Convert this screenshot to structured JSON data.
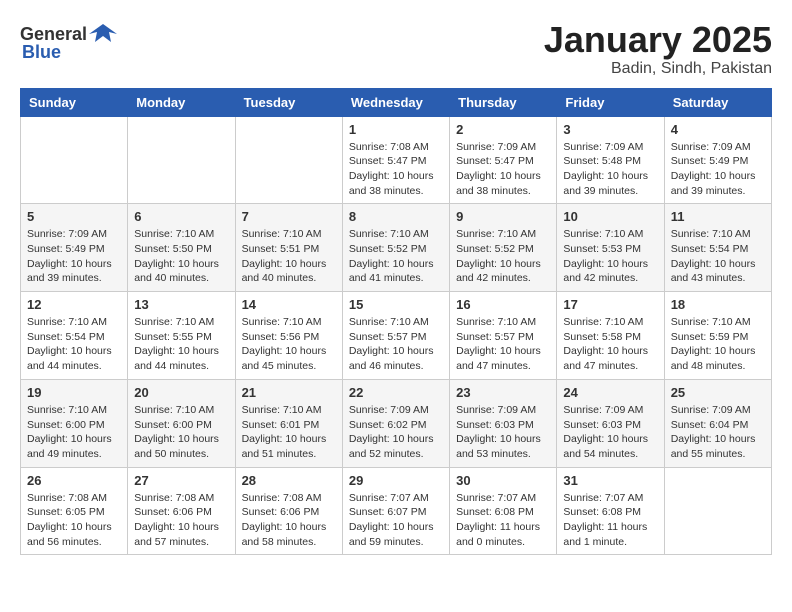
{
  "header": {
    "logo_general": "General",
    "logo_blue": "Blue",
    "month_year": "January 2025",
    "location": "Badin, Sindh, Pakistan"
  },
  "days_of_week": [
    "Sunday",
    "Monday",
    "Tuesday",
    "Wednesday",
    "Thursday",
    "Friday",
    "Saturday"
  ],
  "weeks": [
    [
      {
        "day": "",
        "info": ""
      },
      {
        "day": "",
        "info": ""
      },
      {
        "day": "",
        "info": ""
      },
      {
        "day": "1",
        "info": "Sunrise: 7:08 AM\nSunset: 5:47 PM\nDaylight: 10 hours\nand 38 minutes."
      },
      {
        "day": "2",
        "info": "Sunrise: 7:09 AM\nSunset: 5:47 PM\nDaylight: 10 hours\nand 38 minutes."
      },
      {
        "day": "3",
        "info": "Sunrise: 7:09 AM\nSunset: 5:48 PM\nDaylight: 10 hours\nand 39 minutes."
      },
      {
        "day": "4",
        "info": "Sunrise: 7:09 AM\nSunset: 5:49 PM\nDaylight: 10 hours\nand 39 minutes."
      }
    ],
    [
      {
        "day": "5",
        "info": "Sunrise: 7:09 AM\nSunset: 5:49 PM\nDaylight: 10 hours\nand 39 minutes."
      },
      {
        "day": "6",
        "info": "Sunrise: 7:10 AM\nSunset: 5:50 PM\nDaylight: 10 hours\nand 40 minutes."
      },
      {
        "day": "7",
        "info": "Sunrise: 7:10 AM\nSunset: 5:51 PM\nDaylight: 10 hours\nand 40 minutes."
      },
      {
        "day": "8",
        "info": "Sunrise: 7:10 AM\nSunset: 5:52 PM\nDaylight: 10 hours\nand 41 minutes."
      },
      {
        "day": "9",
        "info": "Sunrise: 7:10 AM\nSunset: 5:52 PM\nDaylight: 10 hours\nand 42 minutes."
      },
      {
        "day": "10",
        "info": "Sunrise: 7:10 AM\nSunset: 5:53 PM\nDaylight: 10 hours\nand 42 minutes."
      },
      {
        "day": "11",
        "info": "Sunrise: 7:10 AM\nSunset: 5:54 PM\nDaylight: 10 hours\nand 43 minutes."
      }
    ],
    [
      {
        "day": "12",
        "info": "Sunrise: 7:10 AM\nSunset: 5:54 PM\nDaylight: 10 hours\nand 44 minutes."
      },
      {
        "day": "13",
        "info": "Sunrise: 7:10 AM\nSunset: 5:55 PM\nDaylight: 10 hours\nand 44 minutes."
      },
      {
        "day": "14",
        "info": "Sunrise: 7:10 AM\nSunset: 5:56 PM\nDaylight: 10 hours\nand 45 minutes."
      },
      {
        "day": "15",
        "info": "Sunrise: 7:10 AM\nSunset: 5:57 PM\nDaylight: 10 hours\nand 46 minutes."
      },
      {
        "day": "16",
        "info": "Sunrise: 7:10 AM\nSunset: 5:57 PM\nDaylight: 10 hours\nand 47 minutes."
      },
      {
        "day": "17",
        "info": "Sunrise: 7:10 AM\nSunset: 5:58 PM\nDaylight: 10 hours\nand 47 minutes."
      },
      {
        "day": "18",
        "info": "Sunrise: 7:10 AM\nSunset: 5:59 PM\nDaylight: 10 hours\nand 48 minutes."
      }
    ],
    [
      {
        "day": "19",
        "info": "Sunrise: 7:10 AM\nSunset: 6:00 PM\nDaylight: 10 hours\nand 49 minutes."
      },
      {
        "day": "20",
        "info": "Sunrise: 7:10 AM\nSunset: 6:00 PM\nDaylight: 10 hours\nand 50 minutes."
      },
      {
        "day": "21",
        "info": "Sunrise: 7:10 AM\nSunset: 6:01 PM\nDaylight: 10 hours\nand 51 minutes."
      },
      {
        "day": "22",
        "info": "Sunrise: 7:09 AM\nSunset: 6:02 PM\nDaylight: 10 hours\nand 52 minutes."
      },
      {
        "day": "23",
        "info": "Sunrise: 7:09 AM\nSunset: 6:03 PM\nDaylight: 10 hours\nand 53 minutes."
      },
      {
        "day": "24",
        "info": "Sunrise: 7:09 AM\nSunset: 6:03 PM\nDaylight: 10 hours\nand 54 minutes."
      },
      {
        "day": "25",
        "info": "Sunrise: 7:09 AM\nSunset: 6:04 PM\nDaylight: 10 hours\nand 55 minutes."
      }
    ],
    [
      {
        "day": "26",
        "info": "Sunrise: 7:08 AM\nSunset: 6:05 PM\nDaylight: 10 hours\nand 56 minutes."
      },
      {
        "day": "27",
        "info": "Sunrise: 7:08 AM\nSunset: 6:06 PM\nDaylight: 10 hours\nand 57 minutes."
      },
      {
        "day": "28",
        "info": "Sunrise: 7:08 AM\nSunset: 6:06 PM\nDaylight: 10 hours\nand 58 minutes."
      },
      {
        "day": "29",
        "info": "Sunrise: 7:07 AM\nSunset: 6:07 PM\nDaylight: 10 hours\nand 59 minutes."
      },
      {
        "day": "30",
        "info": "Sunrise: 7:07 AM\nSunset: 6:08 PM\nDaylight: 11 hours\nand 0 minutes."
      },
      {
        "day": "31",
        "info": "Sunrise: 7:07 AM\nSunset: 6:08 PM\nDaylight: 11 hours\nand 1 minute."
      },
      {
        "day": "",
        "info": ""
      }
    ]
  ]
}
